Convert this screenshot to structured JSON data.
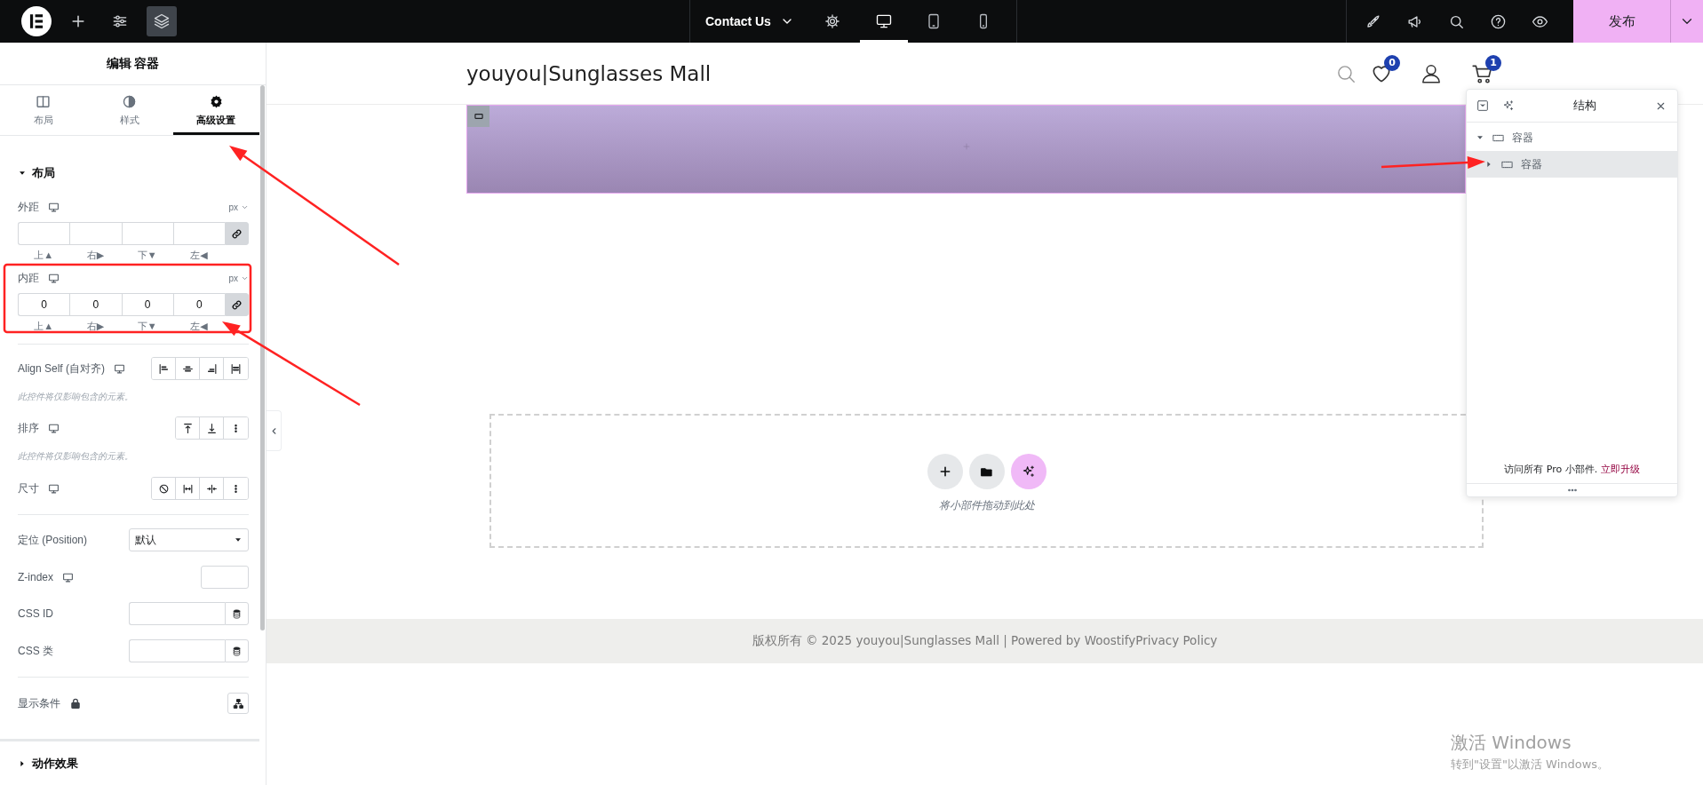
{
  "top_bar": {
    "page_title": "Contact Us",
    "devices": [
      {
        "kind": "desktop",
        "selected": true
      },
      {
        "kind": "tablet",
        "selected": false
      },
      {
        "kind": "mobile",
        "selected": false
      }
    ],
    "publish": "发布"
  },
  "panel": {
    "title": "编辑 容器",
    "tabs": [
      {
        "kind": "layout",
        "label": "布局",
        "selected": false
      },
      {
        "kind": "style",
        "label": "样式",
        "selected": false
      },
      {
        "kind": "advanced",
        "label": "高级设置",
        "selected": true
      }
    ],
    "layout_section": {
      "title": "布局",
      "expanded": true
    },
    "margin": {
      "label": "外距",
      "unit": "px",
      "sides": [
        {
          "label": "上▲"
        },
        {
          "label": "右▶"
        },
        {
          "label": "下▼"
        },
        {
          "label": "左◀"
        }
      ]
    },
    "padding": {
      "label": "内距",
      "unit": "px",
      "sides": [
        {
          "label": "上▲",
          "value": "0"
        },
        {
          "label": "右▶",
          "value": "0"
        },
        {
          "label": "下▼",
          "value": "0"
        },
        {
          "label": "左◀",
          "value": "0"
        }
      ]
    },
    "align_self": {
      "label": "Align Self (自对齐)",
      "note": "此控件将仅影响包含的元素。"
    },
    "order": {
      "label": "排序",
      "note": "此控件将仅影响包含的元素。"
    },
    "size": {
      "label": "尺寸"
    },
    "position": {
      "label": "定位 (Position)",
      "value": "默认"
    },
    "z_index": {
      "label": "Z-index"
    },
    "css_id": {
      "label": "CSS ID"
    },
    "css_class": {
      "label": "CSS 类"
    },
    "display_conditions": {
      "label": "显示条件"
    },
    "motion_section": {
      "title": "动作效果",
      "expanded": false
    }
  },
  "canvas": {
    "site_title": "youyou|Sunglasses Mall",
    "wishlist_count": "0",
    "cart_count": "1",
    "drop_hint": "将小部件拖动到此处",
    "footer": "版权所有 © 2025 youyou|Sunglasses Mall | Powered by WoostifyPrivacy Policy"
  },
  "navigator": {
    "title": "结构",
    "tree": [
      {
        "label": "容器",
        "expanded": true,
        "selected": false,
        "children": [
          {
            "label": "容器",
            "expanded": false,
            "selected": true
          }
        ]
      }
    ],
    "promo": "访问所有 Pro 小部件.",
    "upgrade_link": "立即升级"
  },
  "watermark": {
    "title": "激活 Windows",
    "text": "转到\"设置\"以激活 Windows。"
  }
}
